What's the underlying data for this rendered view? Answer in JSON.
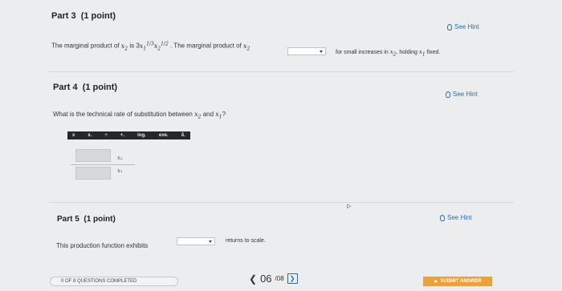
{
  "part3": {
    "title": "Part 3",
    "points": "(1 point)",
    "hint": "See Hint",
    "q_prefix": "The marginal product of",
    "var_x2": "x",
    "sub2": "2",
    "is": "is 3",
    "var_x1": "x",
    "sub1": "1",
    "exp1": "1/3",
    "exp2": "1/2",
    "q_mid": ". The marginal product of",
    "q_suffix_a": "for small increases in",
    "q_suffix_b": ", holding",
    "q_suffix_c": "fixed."
  },
  "part4": {
    "title": "Part 4",
    "points": "(1 point)",
    "hint": "See Hint",
    "q_a": "What is the technical rate of substitution between",
    "q_b": "and",
    "q_c": "?",
    "toolbar": [
      "x",
      "x.",
      "÷",
      "+.",
      "log.",
      "exe.",
      "δ."
    ],
    "numerator": "x₂",
    "denominator": "x₁"
  },
  "part5": {
    "title": "Part 5",
    "points": "(1 point)",
    "hint": "See Hint",
    "q_prefix": "This production function exhibits",
    "q_suffix": "returns to scale."
  },
  "footer": {
    "progress_text": "0 OF 8 QUESTIONS COMPLETED",
    "page_current": "06",
    "page_total": "/08",
    "submit_label": "SUBMIT ANSWER"
  }
}
